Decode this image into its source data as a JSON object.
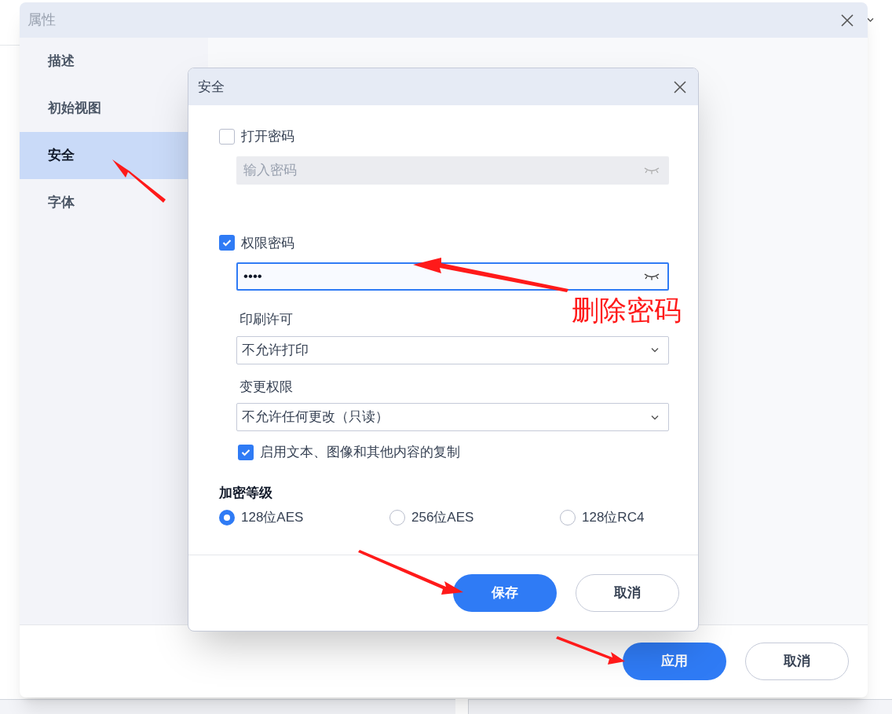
{
  "window": {
    "title": "属性"
  },
  "sidebar": {
    "items": [
      {
        "label": "描述",
        "selected": false
      },
      {
        "label": "初始视图",
        "selected": false
      },
      {
        "label": "安全",
        "selected": true
      },
      {
        "label": "字体",
        "selected": false
      }
    ]
  },
  "footer": {
    "buttons": [
      {
        "label": "应用",
        "kind": "primary"
      },
      {
        "label": "取消",
        "kind": "secondary"
      }
    ]
  },
  "dialog": {
    "title": "安全",
    "open_password": {
      "label": "打开密码",
      "checked": false,
      "placeholder": "输入密码",
      "disabled": true
    },
    "permission_password": {
      "label": "权限密码",
      "checked": true,
      "value": "••••"
    },
    "print_permission": {
      "label": "印刷许可",
      "value": "不允许打印"
    },
    "change_permission": {
      "label": "变更权限",
      "value": "不允许任何更改（只读）"
    },
    "copy_option": {
      "label": "启用文本、图像和其他内容的复制",
      "checked": true
    },
    "encryption": {
      "label": "加密等级",
      "options": [
        {
          "label": "128位AES",
          "selected": true
        },
        {
          "label": "256位AES",
          "selected": false
        },
        {
          "label": "128位RC4",
          "selected": false
        }
      ]
    },
    "buttons": [
      {
        "label": "保存",
        "kind": "primary"
      },
      {
        "label": "取消",
        "kind": "secondary"
      }
    ]
  },
  "annotation": {
    "text": "删除密码"
  }
}
